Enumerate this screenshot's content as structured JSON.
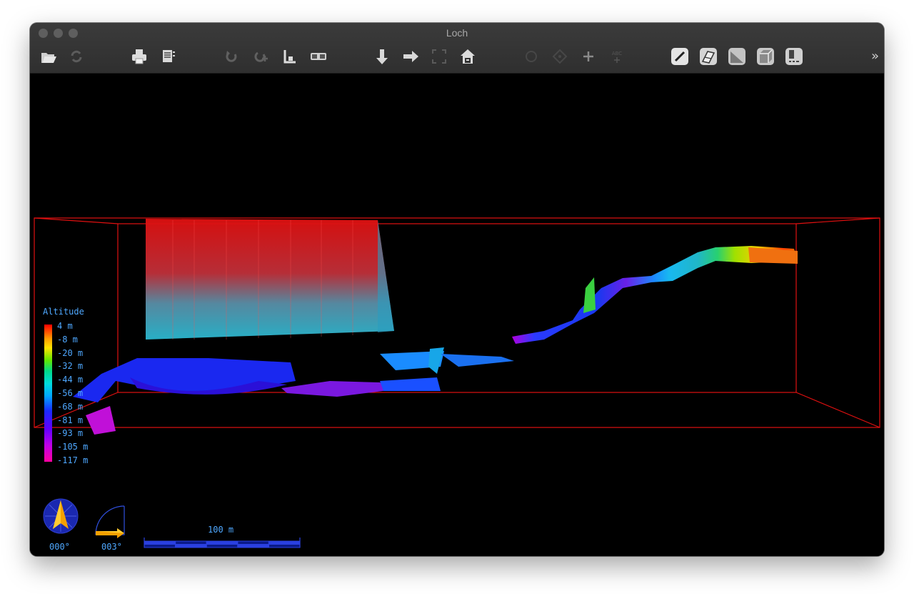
{
  "window": {
    "title": "Loch"
  },
  "toolbar": {
    "more_label": "»",
    "icons": [
      "open-folder-icon",
      "reload-icon",
      "print-icon",
      "export-icon",
      "rotate-icon",
      "rotate-multi-icon",
      "perspective-icon",
      "stereo-glasses-icon",
      "view-down-icon",
      "view-right-icon",
      "fullscreen-icon",
      "home-view-icon",
      "entrance-icon",
      "station-icon",
      "crosshair-icon",
      "labels-icon",
      "centerline-icon",
      "walls-icon",
      "surface-icon",
      "bounding-box-icon",
      "info-panel-icon"
    ]
  },
  "legend": {
    "title": "Altitude",
    "labels": [
      "4 m",
      "-8 m",
      "-20 m",
      "-32 m",
      "-44 m",
      "-56 m",
      "-68 m",
      "-81 m",
      "-93 m",
      "-105 m",
      "-117 m"
    ]
  },
  "compass": {
    "heading": "000°"
  },
  "tilt": {
    "angle": "003°"
  },
  "scalebar": {
    "label": "100 m"
  },
  "colors": {
    "bounding_box": "#e01010",
    "overlay_text": "#4fa8ff",
    "toolbar_bg": "#333333"
  }
}
